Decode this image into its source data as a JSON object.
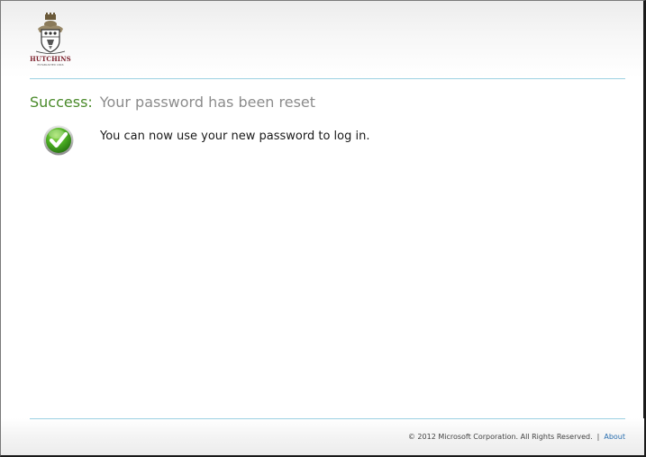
{
  "header": {
    "logo": {
      "icon": "school-crest-icon",
      "name": "HUTCHINS",
      "subtitle": "ESTABLISHED 1846"
    }
  },
  "main": {
    "title_prefix": "Success:",
    "title_message": "Your password has been reset",
    "status_icon": "checkmark-icon",
    "message": "You can now use your new password to log in."
  },
  "footer": {
    "copyright": "© 2012 Microsoft Corporation. All Rights Reserved.",
    "separator": "|",
    "about_link": "About"
  },
  "colors": {
    "success": "#4a8a2a",
    "muted_title": "#8c8c8c",
    "rule": "#9cd1e2",
    "link": "#2a6fb0",
    "crest": "#7a1e2a"
  }
}
